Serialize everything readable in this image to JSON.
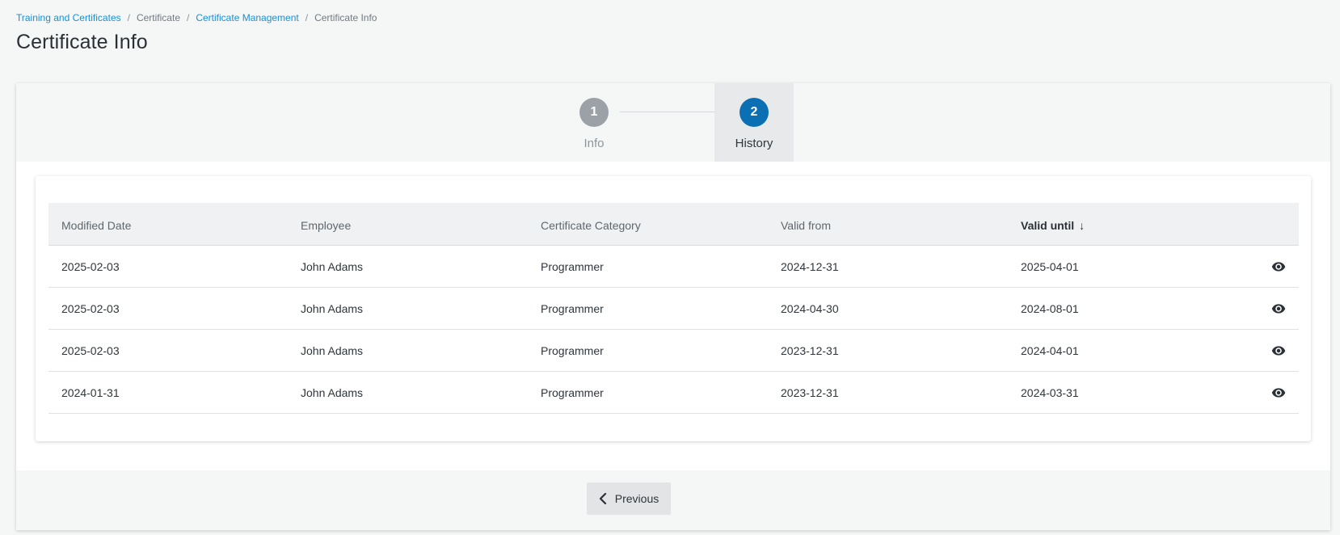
{
  "breadcrumb": [
    {
      "label": "Training and Certificates",
      "link": true
    },
    {
      "label": "Certificate",
      "link": false
    },
    {
      "label": "Certificate Management",
      "link": true
    },
    {
      "label": "Certificate Info",
      "link": false
    }
  ],
  "breadcrumb_separator": "/",
  "page_title": "Certificate Info",
  "wizard": {
    "steps": [
      {
        "number": "1",
        "label": "Info",
        "state": "inactive"
      },
      {
        "number": "2",
        "label": "History",
        "state": "active"
      }
    ]
  },
  "table": {
    "columns": [
      "Modified Date",
      "Employee",
      "Certificate Category",
      "Valid from",
      "Valid until"
    ],
    "sort_indicator": "↓",
    "sorted_column": "Valid until",
    "rows": [
      [
        "2025-02-03",
        "John Adams",
        "Programmer",
        "2024-12-31",
        "2025-04-01"
      ],
      [
        "2025-02-03",
        "John Adams",
        "Programmer",
        "2024-04-30",
        "2024-08-01"
      ],
      [
        "2025-02-03",
        "John Adams",
        "Programmer",
        "2023-12-31",
        "2024-04-01"
      ],
      [
        "2024-01-31",
        "John Adams",
        "Programmer",
        "2023-12-31",
        "2024-03-31"
      ]
    ],
    "row_action_icon": "eye-icon"
  },
  "footer": {
    "previous_label": "Previous",
    "previous_icon": "chevron-left-icon"
  },
  "colors": {
    "link": "#1a8fd6",
    "active_step": "#0b6fb3",
    "inactive_step": "#9ba1a7"
  }
}
